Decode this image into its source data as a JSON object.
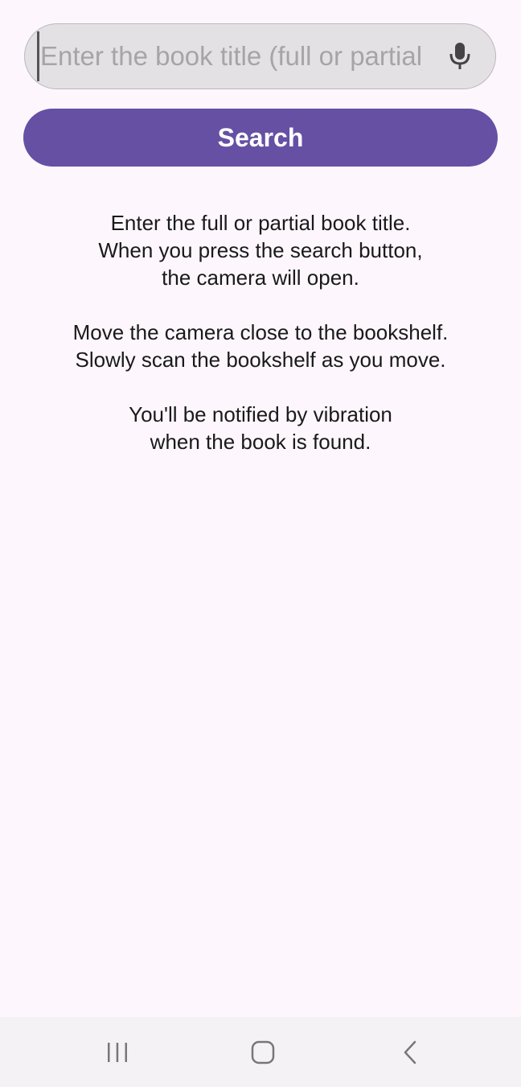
{
  "search": {
    "placeholder": "Enter the book title (full or partial)",
    "value": "",
    "mic_icon": "mic-icon"
  },
  "search_button": {
    "label": "Search"
  },
  "instructions": {
    "paragraph_1": "Enter the full or partial book title.\nWhen you press the search button,\nthe camera will open.",
    "paragraph_2": "Move the camera close to the bookshelf.\nSlowly scan the bookshelf as you move.",
    "paragraph_3": "You'll be notified by vibration\nwhen the book is found."
  },
  "navigation": {
    "recents_icon": "recents-icon",
    "home_icon": "home-icon",
    "back_icon": "back-icon"
  },
  "colors": {
    "accent": "#6650a4",
    "background": "#fdf7fd",
    "field_background": "#e3e1e4"
  }
}
